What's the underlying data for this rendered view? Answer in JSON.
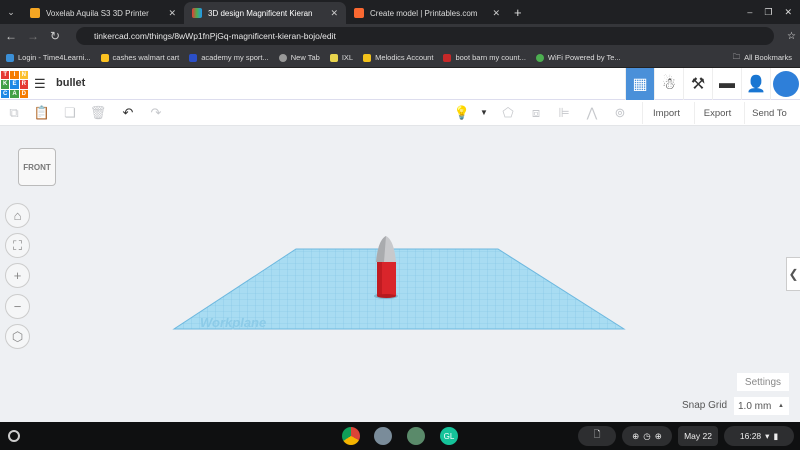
{
  "browser": {
    "tabs": [
      {
        "title": "Voxelab Aquila S3 3D Printer",
        "color": "#f5a623"
      },
      {
        "title": "3D design Magnificent Kieran",
        "color": "#4caf50"
      },
      {
        "title": "Create model | Printables.com",
        "color": "#fa6831"
      }
    ],
    "url": "tinkercad.com/things/8wWp1fnPjGq-magnificent-kieran-bojo/edit",
    "bookmarks": [
      "Login - Time4Learni...",
      "cashes walmart cart",
      "academy my sport...",
      "New Tab",
      "IXL",
      "Melodics Account",
      "boot barn my count...",
      "WiFi Powered by Te..."
    ],
    "all_bookmarks": "All Bookmarks"
  },
  "app": {
    "logo": [
      "T",
      "I",
      "N",
      "K",
      "E",
      "R",
      "C",
      "A",
      "D"
    ],
    "design_name": "bullet",
    "buttons": {
      "import": "Import",
      "export": "Export",
      "send_to": "Send To"
    },
    "viewcube": "FRONT",
    "workplane": "Workplane",
    "settings": "Settings",
    "snap_grid_label": "Snap Grid",
    "snap_grid_value": "1.0 mm",
    "accent": "#4a90d9"
  },
  "shelf": {
    "date": "May 22",
    "time": "16:28"
  }
}
